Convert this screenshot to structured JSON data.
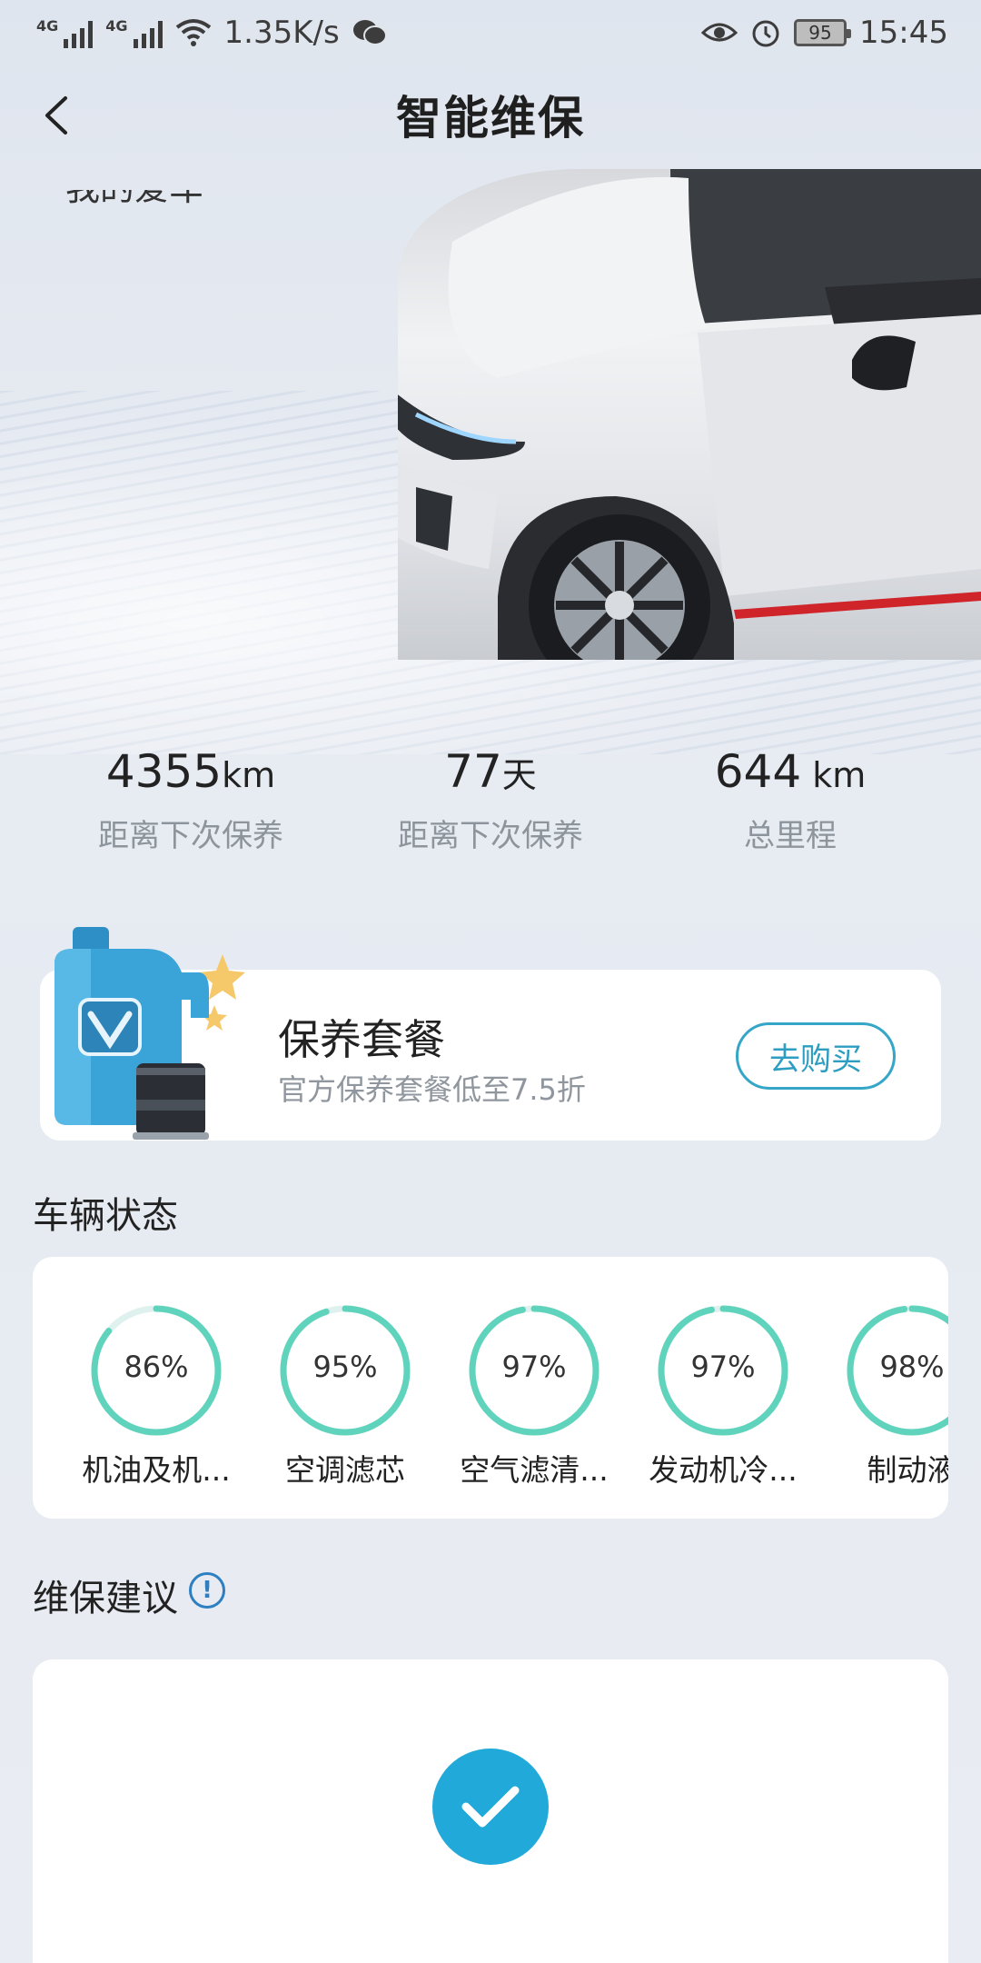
{
  "status_bar": {
    "network1": "4G",
    "network2": "4G",
    "speed": "1.35K/s",
    "battery": "95",
    "time": "15:45"
  },
  "header": {
    "title": "智能维保"
  },
  "hero": {
    "my_car_label": "我的爱车"
  },
  "stats": [
    {
      "value": "4355",
      "unit": "km",
      "label": "距离下次保养"
    },
    {
      "value": "77",
      "unit": "天",
      "label": "距离下次保养"
    },
    {
      "value": "644",
      "unit": " km",
      "label": "总里程"
    }
  ],
  "promo": {
    "title": "保养套餐",
    "subtitle": "官方保养套餐低至7.5折",
    "button": "去购买"
  },
  "vehicle_status": {
    "title": "车辆状态",
    "items": [
      {
        "percent": "86%",
        "value": 0.86,
        "name": "机油及机..."
      },
      {
        "percent": "95%",
        "value": 0.95,
        "name": "空调滤芯"
      },
      {
        "percent": "97%",
        "value": 0.97,
        "name": "空气滤清..."
      },
      {
        "percent": "97%",
        "value": 0.97,
        "name": "发动机冷..."
      },
      {
        "percent": "98%",
        "value": 0.98,
        "name": "制动液"
      }
    ]
  },
  "suggestion": {
    "title": "维保建议",
    "info_icon": "!"
  },
  "colors": {
    "accent": "#35a6c7",
    "gauge": "#5fd3bb",
    "check": "#21a9d9"
  }
}
